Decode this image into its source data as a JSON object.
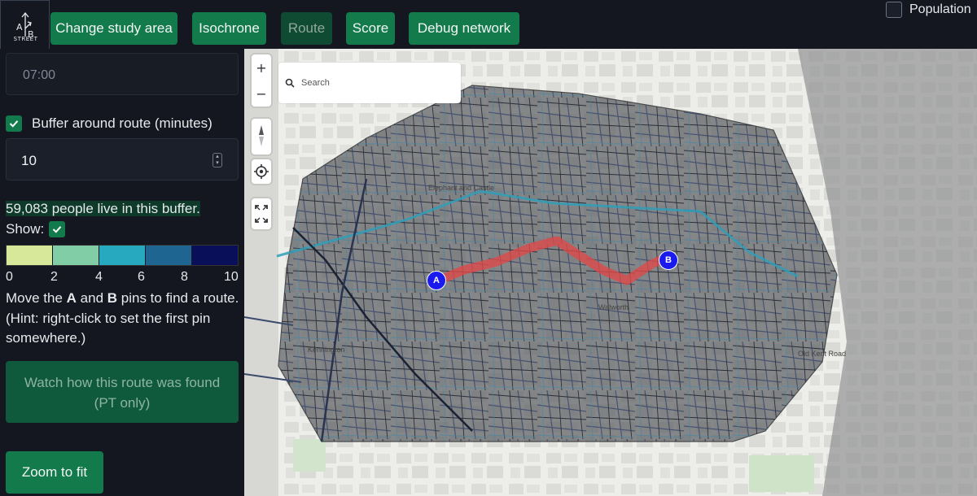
{
  "app": {
    "logo_text": "STREET",
    "logo_letters": [
      "A",
      "B"
    ]
  },
  "toolbar": {
    "buttons": [
      {
        "label": "Change study area",
        "active": false
      },
      {
        "label": "Isochrone",
        "active": false
      },
      {
        "label": "Route",
        "active": true
      },
      {
        "label": "Score",
        "active": false
      },
      {
        "label": "Debug network",
        "active": false
      }
    ],
    "population_label": "Population",
    "population_checked": false
  },
  "sidebar": {
    "time_value": "07:00",
    "buffer_label": "Buffer around route (minutes)",
    "buffer_checked": true,
    "buffer_value": "10",
    "people_text": "59,083 people live in this buffer.",
    "show_label": "Show:",
    "show_checked": true,
    "legend_colors": [
      "#d8e89a",
      "#80cda6",
      "#27a9bf",
      "#1e6592",
      "#0a0f5a"
    ],
    "legend_ticks": [
      "0",
      "2",
      "4",
      "6",
      "8",
      "10"
    ],
    "hint_pre": "Move the ",
    "hint_a": "A",
    "hint_mid": " and ",
    "hint_b": "B",
    "hint_post": " pins to find a route.",
    "hint_2": "(Hint: right-click to set the first pin somewhere.)",
    "watch_label_1": "Watch how this route was found",
    "watch_label_2": "(PT only)",
    "zoom_fit_label": "Zoom to fit"
  },
  "map": {
    "search_placeholder": "Search",
    "controls": [
      "+",
      "−"
    ],
    "labels": {
      "elephant": "Elephant and Castle",
      "walworth": "Walworth",
      "kennington": "Kennington",
      "old_kent": "Old Kent Road"
    },
    "pin_a": "A",
    "pin_b": "B",
    "route_color": "#e04848",
    "colors": {
      "accent": "#137a4c",
      "pin": "#1a1aef"
    }
  }
}
